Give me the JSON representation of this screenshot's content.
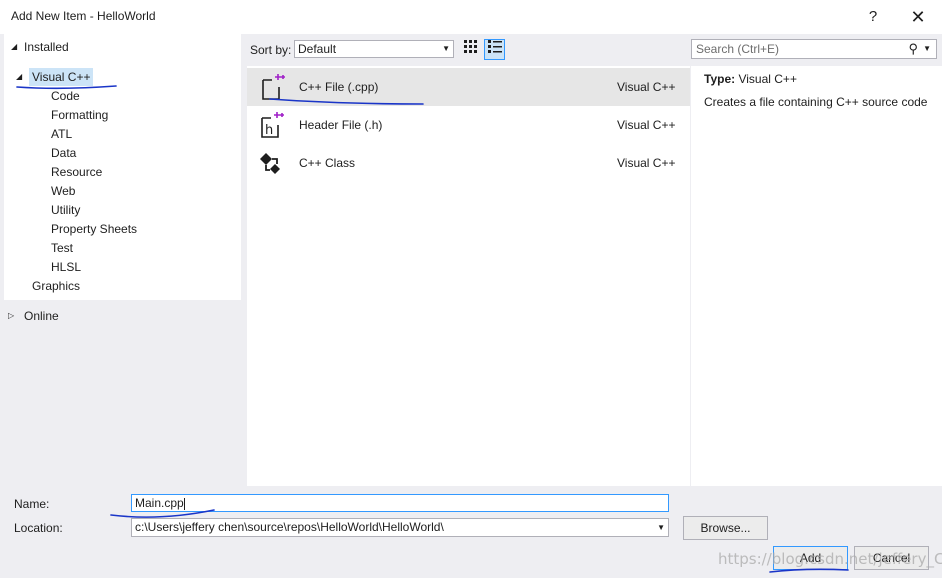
{
  "window": {
    "title": "Add New Item - HelloWorld",
    "help_label": "?",
    "close_label": "✕"
  },
  "tree": {
    "installed_label": "Installed",
    "visual_cpp_label": "Visual C++",
    "children": [
      "Code",
      "Formatting",
      "ATL",
      "Data",
      "Resource",
      "Web",
      "Utility",
      "Property Sheets",
      "Test",
      "HLSL"
    ],
    "graphics_label": "Graphics",
    "online_label": "Online"
  },
  "toolbar": {
    "sort_label": "Sort by:",
    "sort_value": "Default",
    "search_placeholder": "Search (Ctrl+E)"
  },
  "templates": [
    {
      "name": "C++ File (.cpp)",
      "language": "Visual C++",
      "icon": "cpp-file-icon",
      "selected": true
    },
    {
      "name": "Header File (.h)",
      "language": "Visual C++",
      "icon": "header-file-icon",
      "selected": false
    },
    {
      "name": "C++ Class",
      "language": "Visual C++",
      "icon": "cpp-class-icon",
      "selected": false
    }
  ],
  "details": {
    "type_label": "Type:",
    "type_value": "Visual C++",
    "description": "Creates a file containing C++ source code"
  },
  "form": {
    "name_label": "Name:",
    "name_value": "Main.cpp",
    "location_label": "Location:",
    "location_value": "c:\\Users\\jeffery chen\\source\\repos\\HelloWorld\\HelloWorld\\",
    "browse_label": "Browse...",
    "add_label": "Add",
    "cancel_label": "Cancel"
  },
  "watermark": "https://blog.csdn.net/jeffery_CF",
  "colors": {
    "selection": "#cce4f7",
    "accent": "#3399ff",
    "annotation_ink": "#1a35c8",
    "panel_bg": "#eeeef2"
  }
}
